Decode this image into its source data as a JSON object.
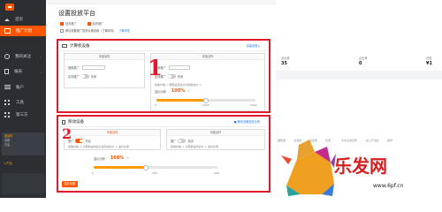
{
  "sidebar": {
    "items": [
      {
        "label": "首页",
        "icon": "home-icon",
        "active": false
      },
      {
        "label": "推广计划",
        "icon": "box-icon",
        "active": true
      },
      {
        "label": "我的关注",
        "icon": "circle-icon",
        "active": false
      },
      {
        "label": "报表",
        "icon": "doc-icon",
        "active": false
      },
      {
        "label": "账户",
        "icon": "bars-icon",
        "active": false
      },
      {
        "label": "工具",
        "icon": "grid-icon",
        "active": false
      },
      {
        "label": "第三方",
        "icon": "grid-icon",
        "active": false
      }
    ],
    "panel_lines": [
      "直通车",
      "余额",
      "开启"
    ],
    "link": "人产品"
  },
  "main": {
    "title": "设置投放平台",
    "checks": [
      {
        "label": "站内推广",
        "checked": true
      },
      {
        "label": "站外推广",
        "checked": true
      },
      {
        "label": "了解详情",
        "checked": false
      }
    ],
    "note_line": "移动设备推广投放价格设置（了解详情）"
  },
  "card1": {
    "marker": "1",
    "title": "计算机设备",
    "link": "高级设置 ▸",
    "panel_left": {
      "title": "淘宝站内",
      "fields": [
        "搜索推广",
        "定向推广"
      ]
    },
    "panel_right": {
      "title": "淘宝站外",
      "fields": [
        "搜索推广",
        "定向推广"
      ],
      "note": "投放价格 = 按照设定出价比例的出价 ×",
      "percent_label": "溢价比例",
      "percent": "100",
      "unit": "%"
    },
    "slider_ticks": [
      "0",
      "1000",
      "2000"
    ],
    "slider_value": 0.5,
    "toggle_labels": [
      "关闭",
      "关闭",
      "关闭",
      "关闭"
    ]
  },
  "card2": {
    "marker": "2",
    "title": "移动设备",
    "link": "移动设备投放比例",
    "panel_left": {
      "title": "淘宝站内",
      "fields": [
        "推广",
        "开启"
      ],
      "note": "投放价格 = 计算机站内出价设定的出价 × 溢价比例"
    },
    "panel_right": {
      "title": "淘宝站外",
      "fields": [
        "推广",
        "关闭"
      ],
      "note": "投放价格 = 计算机站外出价 × 溢价比例"
    },
    "percent_label": "溢价比例",
    "percent": "168",
    "unit": "%",
    "slider_ticks": [
      "0",
      "200",
      "400"
    ],
    "slider_value": 0.42,
    "save_label": "保存设置"
  },
  "right": {
    "stats": [
      {
        "label": "点击量",
        "value": "35"
      },
      {
        "label": "点击率",
        "value": "0"
      },
      {
        "label": "花费",
        "value": "¥1"
      }
    ],
    "table_heads": [
      "展现量",
      "点击量",
      "点击率",
      "花费",
      "平均点击花费",
      "投入产出比",
      "操作"
    ]
  },
  "watermark": {
    "text": "乐发网",
    "url": "www.6pf.cn"
  }
}
